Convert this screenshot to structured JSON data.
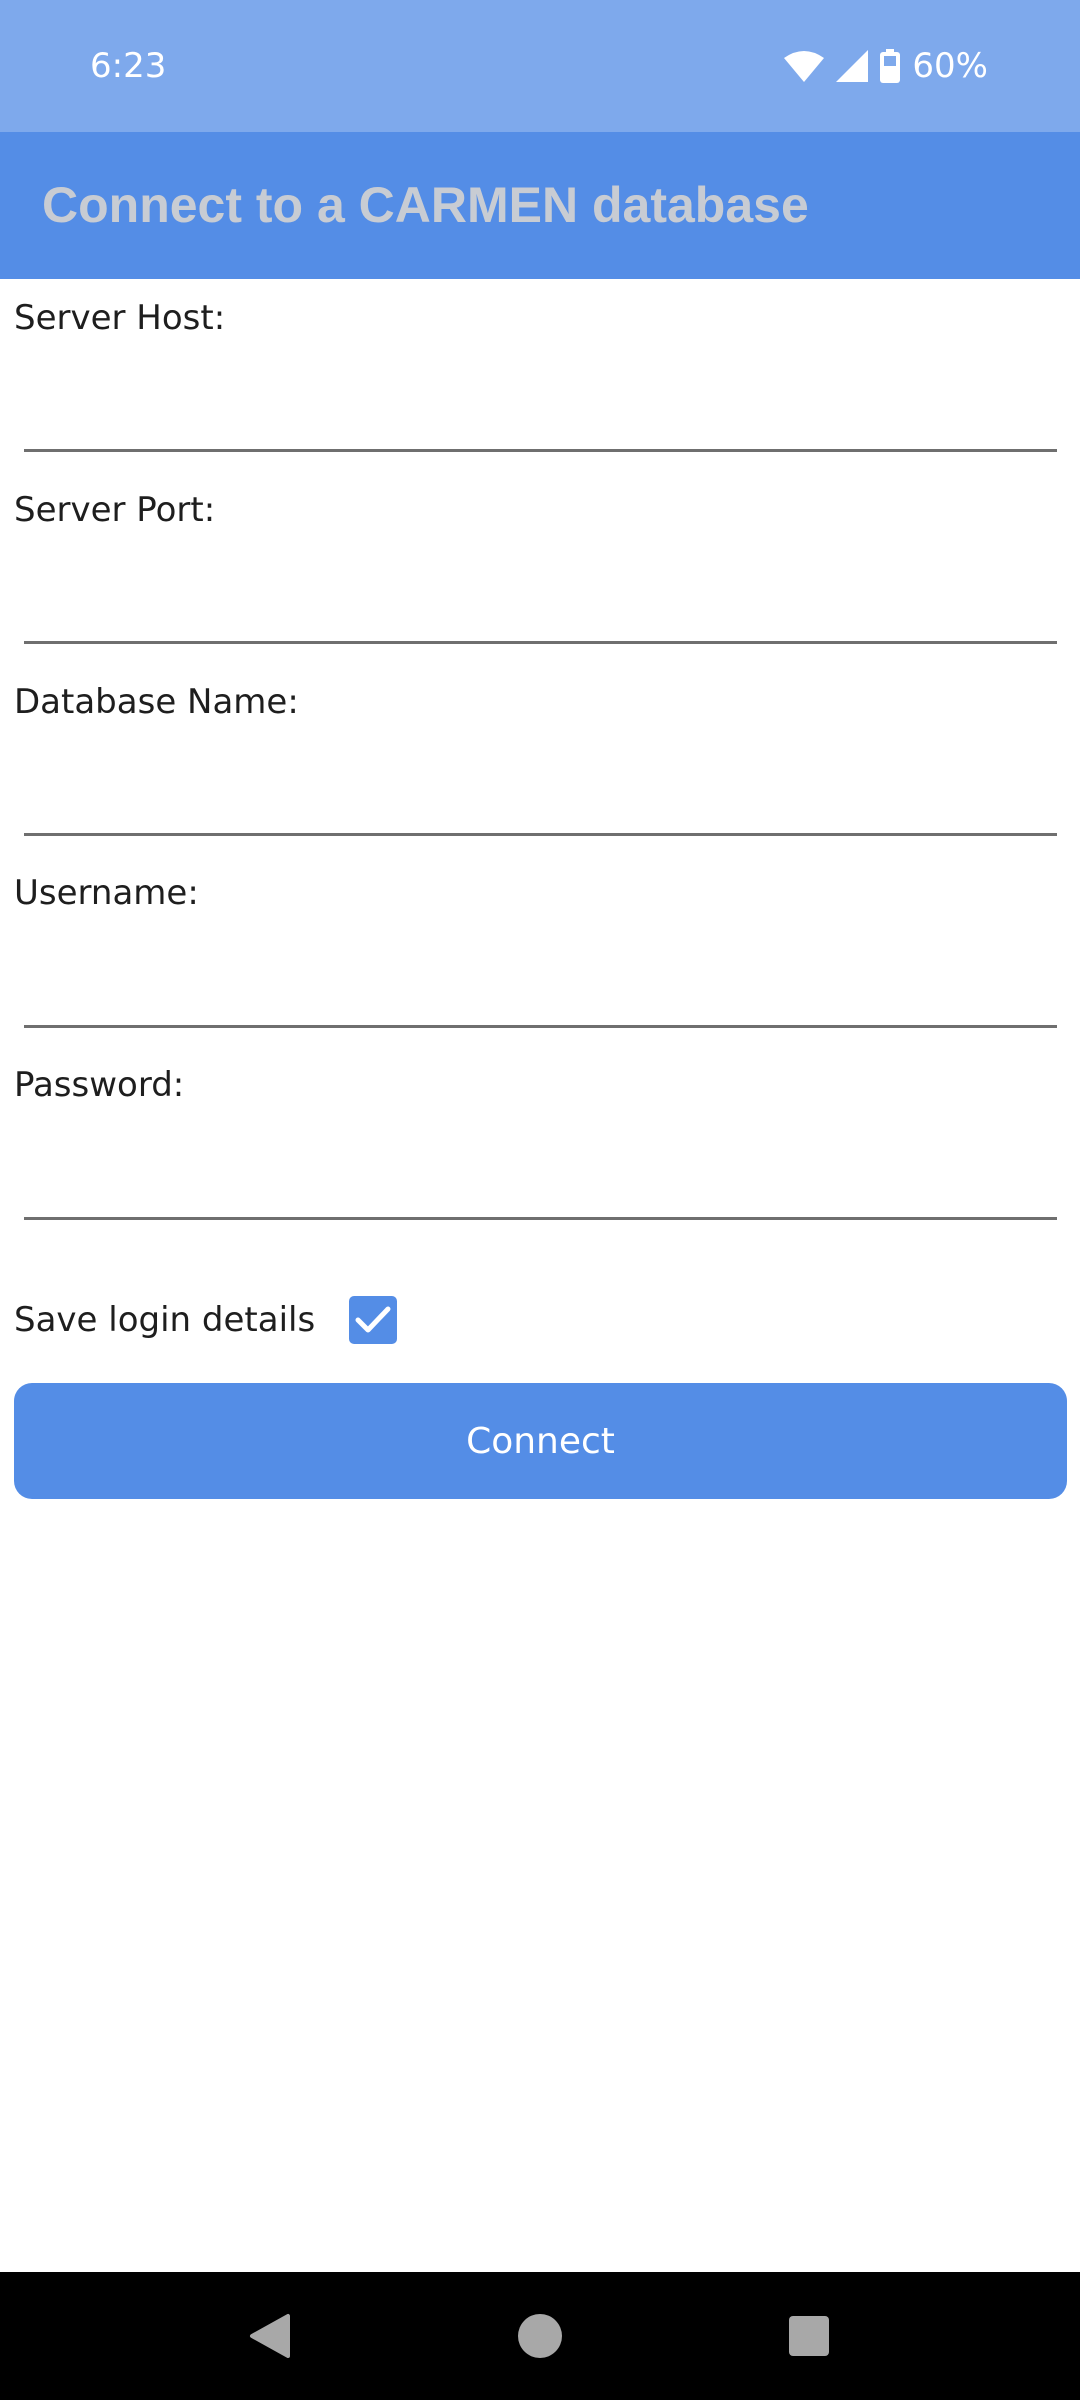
{
  "status_bar": {
    "time": "6:23",
    "battery": "60%",
    "icons": [
      "wifi-icon",
      "signal-icon",
      "battery-icon"
    ]
  },
  "app_bar": {
    "title": "Connect to a CARMEN database"
  },
  "form": {
    "fields": [
      {
        "label": "Server Host:",
        "value": ""
      },
      {
        "label": "Server Port:",
        "value": ""
      },
      {
        "label": "Database Name:",
        "value": ""
      },
      {
        "label": "Username:",
        "value": ""
      },
      {
        "label": "Password:",
        "value": ""
      }
    ],
    "save_login_label": "Save login details",
    "save_login_checked": true,
    "connect_label": "Connect"
  },
  "nav_bar": {
    "icons": [
      "back-icon",
      "home-icon",
      "recents-icon"
    ]
  },
  "colors": {
    "status_bar": "#7ea9ec",
    "primary": "#548de6",
    "title_text": "#c8ccd3"
  }
}
